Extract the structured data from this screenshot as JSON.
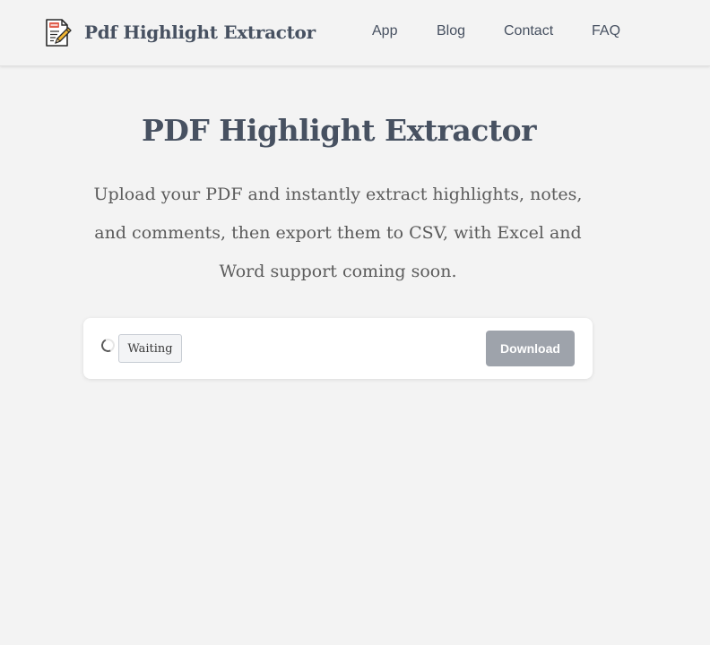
{
  "header": {
    "brand_name": "Pdf Highlight Extractor",
    "logo_icon": "pdf-document-pencil-icon",
    "nav": [
      {
        "label": "App"
      },
      {
        "label": "Blog"
      },
      {
        "label": "Contact"
      },
      {
        "label": "FAQ"
      }
    ]
  },
  "hero": {
    "title": "PDF Highlight Extractor",
    "description": "Upload your PDF and instantly extract highlights, notes, and comments, then export them to CSV, with Excel and Word support coming soon."
  },
  "uploader": {
    "status_icon": "loading-spinner-icon",
    "status_label": "Waiting",
    "download_label": "Download",
    "download_enabled": false
  },
  "colors": {
    "page_background": "#f3f3f3",
    "text_primary": "#475161",
    "button_disabled": "#9ea3ab",
    "logo_badge": "#e0614f"
  }
}
